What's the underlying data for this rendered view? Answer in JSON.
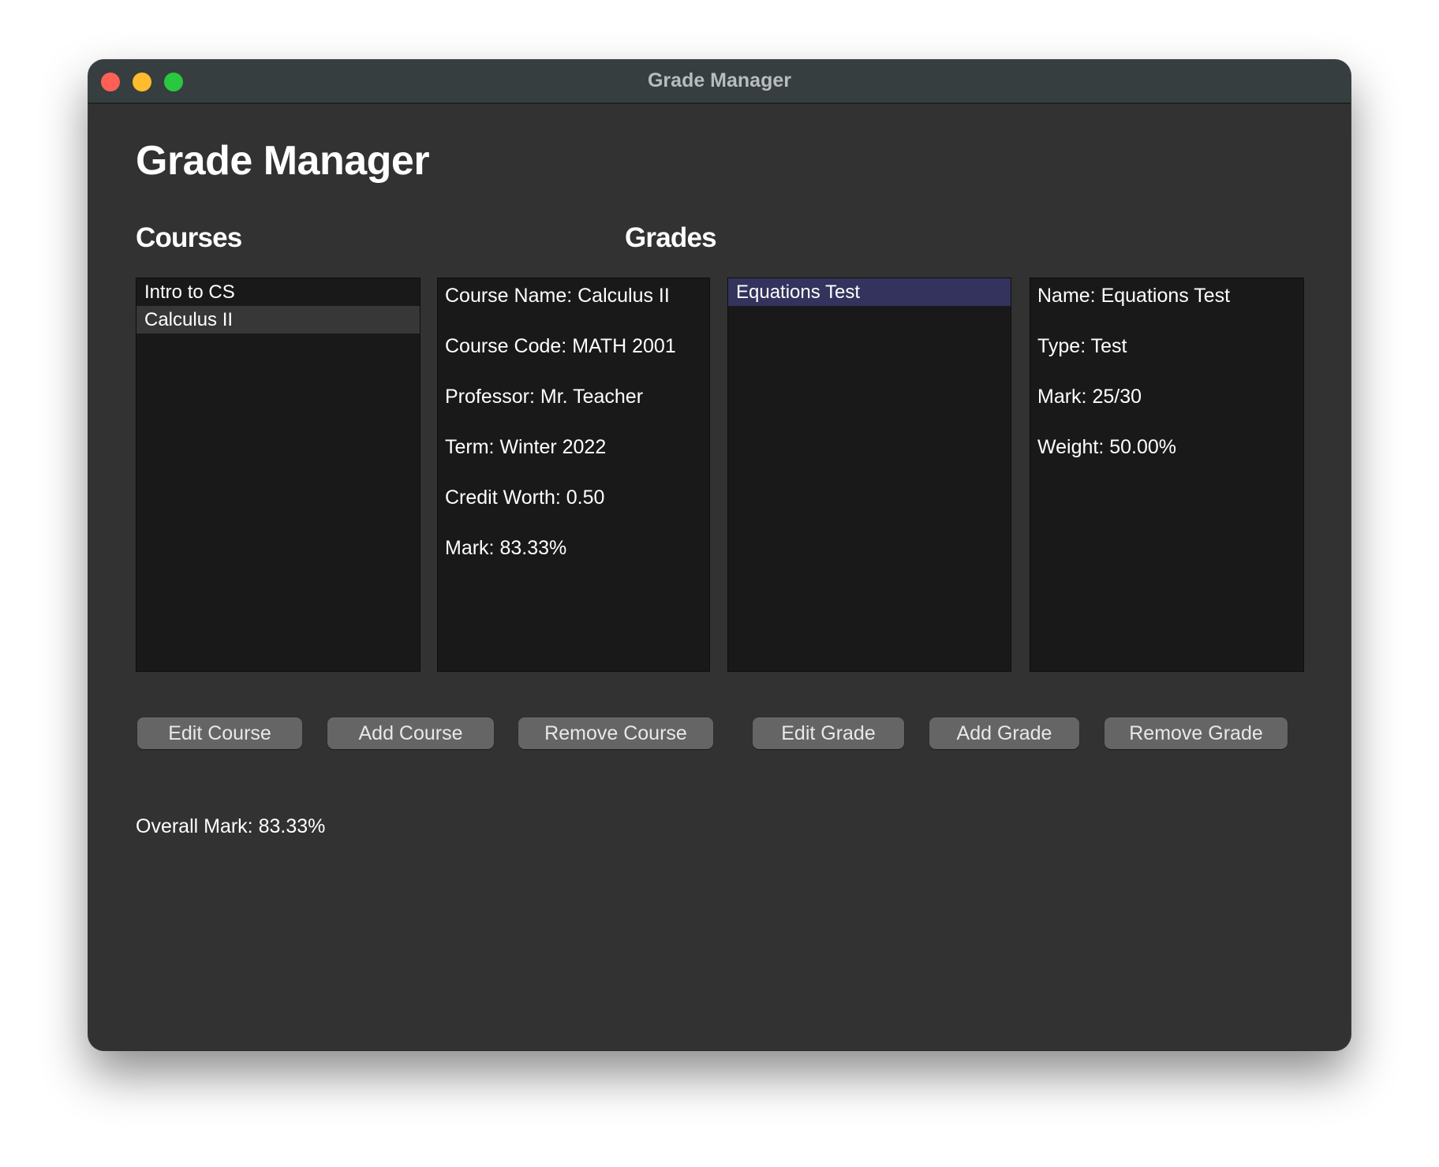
{
  "window": {
    "title": "Grade Manager",
    "controls": [
      "close",
      "minimize",
      "maximize"
    ]
  },
  "app": {
    "title": "Grade Manager"
  },
  "courses": {
    "heading": "Courses",
    "items": [
      {
        "label": "Intro to CS",
        "selected": false
      },
      {
        "label": "Calculus II",
        "selected": true
      }
    ],
    "details": {
      "name": "Course Name: Calculus II",
      "code": "Course Code: MATH 2001",
      "professor": "Professor: Mr. Teacher",
      "term": "Term: Winter 2022",
      "credit": "Credit Worth: 0.50",
      "mark": "Mark: 83.33%"
    },
    "buttons": {
      "edit": "Edit Course",
      "add": "Add Course",
      "remove": "Remove Course"
    }
  },
  "grades": {
    "heading": "Grades",
    "items": [
      {
        "label": "Equations Test",
        "selected": true
      }
    ],
    "details": {
      "name": "Name: Equations Test",
      "type": "Type: Test",
      "mark": "Mark: 25/30",
      "weight": "Weight: 50.00%"
    },
    "buttons": {
      "edit": "Edit Grade",
      "add": "Add Grade",
      "remove": "Remove Grade"
    }
  },
  "overall_mark": "Overall Mark: 83.33%",
  "colors": {
    "window_bg": "#323232",
    "titlebar_bg": "#373e40",
    "panel_bg": "#191919",
    "course_selection": "#373737",
    "grade_selection": "#33335e",
    "button_bg": "#656565",
    "close": "#fe5f57",
    "minimize": "#febc2e",
    "maximize": "#28c840"
  }
}
